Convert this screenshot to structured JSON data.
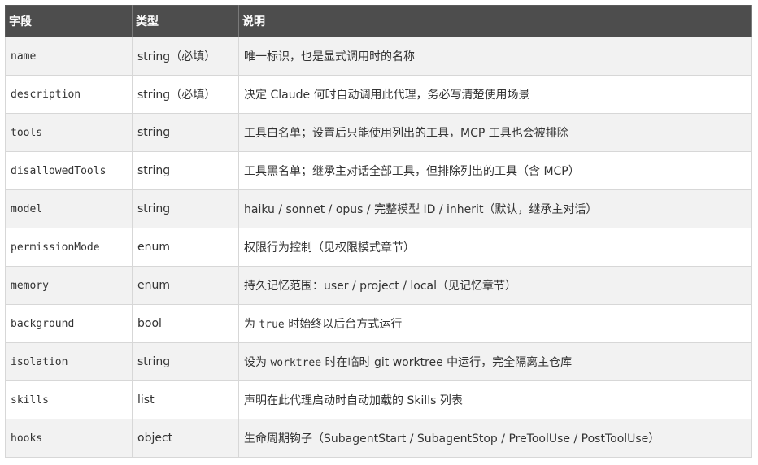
{
  "table": {
    "headers": [
      "字段",
      "类型",
      "说明"
    ],
    "rows": [
      {
        "field": "name",
        "type": "string（必填）",
        "desc": [
          "唯一标识，也是显式调用时的名称"
        ]
      },
      {
        "field": "description",
        "type": "string（必填）",
        "desc": [
          "决定 Claude 何时自动调用此代理，务必写清楚使用场景"
        ]
      },
      {
        "field": "tools",
        "type": "string",
        "desc": [
          "工具白名单；设置后只能使用列出的工具，MCP 工具也会被排除"
        ]
      },
      {
        "field": "disallowedTools",
        "type": "string",
        "desc": [
          "工具黑名单；继承主对话全部工具，但排除列出的工具（含 MCP）"
        ]
      },
      {
        "field": "model",
        "type": "string",
        "desc": [
          "haiku / sonnet / opus / 完整模型 ID / inherit（默认，继承主对话）"
        ]
      },
      {
        "field": "permissionMode",
        "type": "enum",
        "desc": [
          "权限行为控制（见权限模式章节）"
        ]
      },
      {
        "field": "memory",
        "type": "enum",
        "desc": [
          "持久记忆范围：user / project / local（见记忆章节）"
        ]
      },
      {
        "field": "background",
        "type": "bool",
        "desc": [
          "为 ",
          {
            "code": "true"
          },
          " 时始终以后台方式运行"
        ]
      },
      {
        "field": "isolation",
        "type": "string",
        "desc": [
          "设为 ",
          {
            "code": "worktree"
          },
          " 时在临时 git worktree 中运行，完全隔离主仓库"
        ]
      },
      {
        "field": "skills",
        "type": "list",
        "desc": [
          "声明在此代理启动时自动加载的 Skills 列表"
        ]
      },
      {
        "field": "hooks",
        "type": "object",
        "desc": [
          "生命周期钩子（SubagentStart / SubagentStop / PreToolUse / PostToolUse）"
        ]
      }
    ]
  }
}
